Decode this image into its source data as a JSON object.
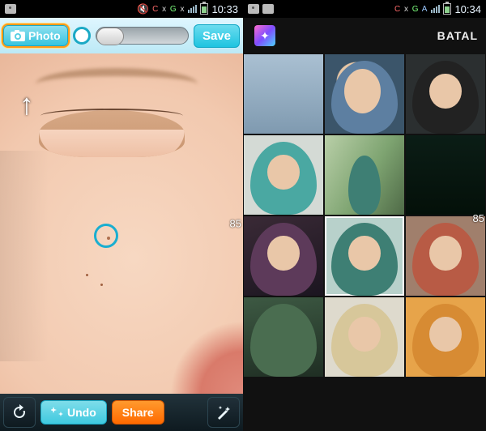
{
  "left": {
    "status": {
      "time": "10:33",
      "carrier_cg": [
        "C",
        "x",
        "G",
        "x"
      ]
    },
    "toolbar_top": {
      "photo_label": "Photo",
      "save_label": "Save"
    },
    "canvas": {
      "page_indicator": "85"
    },
    "toolbar_bottom": {
      "undo_label": "Undo",
      "share_label": "Share"
    }
  },
  "right": {
    "status": {
      "time": "10:34",
      "carrier_cg": [
        "C",
        "x",
        "G",
        "A"
      ]
    },
    "toolbar_top": {
      "batal_label": "BATAL"
    },
    "gallery": {
      "page_indicator": "85",
      "items": [
        {
          "id": 0
        },
        {
          "id": 1
        },
        {
          "id": 2
        },
        {
          "id": 3
        },
        {
          "id": 4
        },
        {
          "id": 5
        },
        {
          "id": 6
        },
        {
          "id": 7,
          "selected": true
        },
        {
          "id": 8
        },
        {
          "id": 9
        },
        {
          "id": 10
        },
        {
          "id": 11
        }
      ]
    }
  }
}
